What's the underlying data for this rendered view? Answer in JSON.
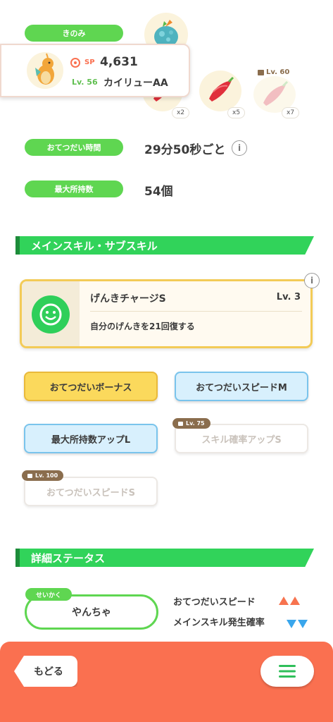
{
  "ingredients": {
    "label": "きのみ",
    "counts": [
      "x2",
      "x5",
      "x7"
    ],
    "lock_level": "Lv. 60"
  },
  "pokemon": {
    "sp_label": "SP",
    "sp_value": "4,631",
    "level": "Lv. 56",
    "name": "カイリューAA"
  },
  "help_time": {
    "label": "おてつだい時間",
    "value": "29分50秒ごと"
  },
  "max_carry": {
    "label": "最大所持数",
    "value": "54個"
  },
  "skills_section": {
    "title": "メインスキル・サブスキル"
  },
  "main_skill": {
    "name": "げんきチャージS",
    "level": "Lv. 3",
    "description": "自分のげんきを21回復する"
  },
  "subskills": [
    {
      "label": "おてつだいボーナス",
      "style": "gold"
    },
    {
      "label": "おてつだいスピードM",
      "style": "blue"
    },
    {
      "label": "最大所持数アップL",
      "style": "blue"
    },
    {
      "label": "スキル確率アップS",
      "style": "locked",
      "lock_level": "Lv. 75"
    },
    {
      "label": "おてつだいスピードS",
      "style": "locked",
      "lock_level": "Lv. 100"
    }
  ],
  "detail_section": {
    "title": "詳細ステータス"
  },
  "nature": {
    "tag": "せいかく",
    "value": "やんちゃ",
    "up_stat": "おてつだいスピード",
    "down_stat": "メインスキル発生確率",
    "up_color": "#f7734f",
    "down_color": "#3aa6ec"
  },
  "nav": {
    "back_label": "もどる"
  },
  "colors": {
    "green": "#5fd651",
    "accent": "#fa7050"
  }
}
